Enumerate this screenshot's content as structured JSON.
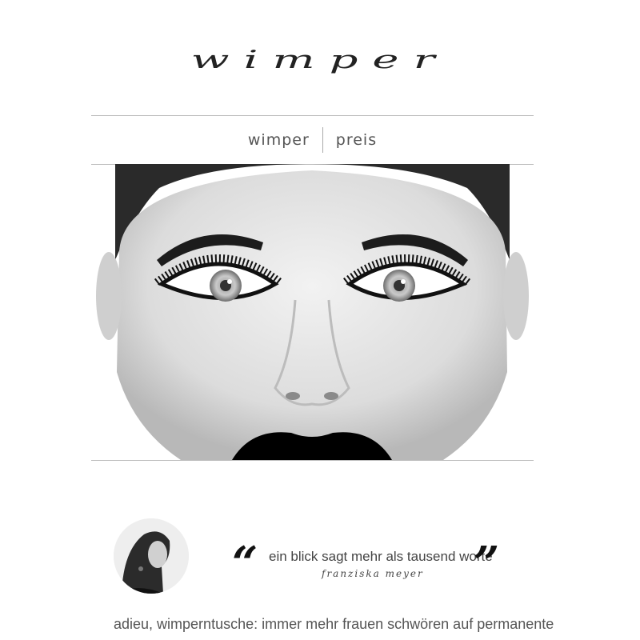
{
  "logo": {
    "text": "wimper"
  },
  "nav": {
    "items": [
      {
        "label": "wimper"
      },
      {
        "label": "preis"
      }
    ]
  },
  "quote": {
    "text": "ein blick sagt mehr als tausend worte",
    "author": "franziska meyer"
  },
  "article": {
    "headline": "adieu, wimperntusche: immer mehr frauen schwören auf permanente"
  },
  "colors": {
    "line": "#bdbdbd",
    "text": "#444444",
    "lips": "#000000"
  }
}
